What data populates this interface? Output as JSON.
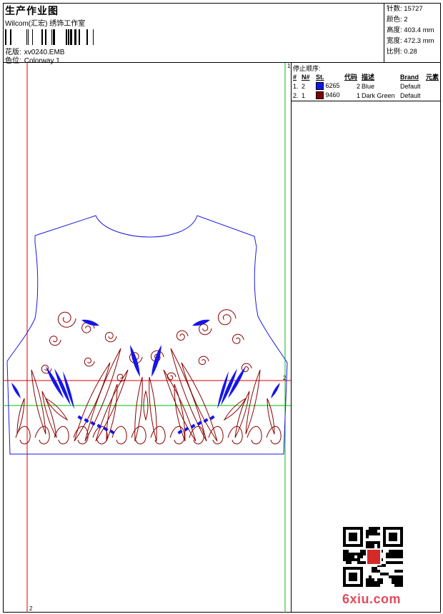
{
  "header": {
    "title": "生产作业图",
    "company": "Wilcom(汇宏) 绣饰工作室",
    "design_label": "花版:",
    "design_value": "xv0240.EMB",
    "colorway_label": "色位:",
    "colorway_value": "Colorway 1"
  },
  "stats": [
    {
      "label": "针数:",
      "value": "15727"
    },
    {
      "label": "颜色:",
      "value": "2"
    },
    {
      "label": "高度:",
      "value": "403.4 mm"
    },
    {
      "label": "宽度:",
      "value": "472.3 mm"
    },
    {
      "label": "比例:",
      "value": "0.28"
    }
  ],
  "stop_order": {
    "title": "停止顺序:",
    "columns": [
      "#",
      "N#",
      "St.",
      "代码",
      "描述",
      "Brand",
      "元素"
    ],
    "rows": [
      {
        "num": "1.",
        "n": "2",
        "code": "6265",
        "st": "2",
        "desc": "Blue",
        "brand": "Default",
        "color": "#1515e8"
      },
      {
        "num": "2.",
        "n": "1",
        "code": "9460",
        "st": "1",
        "desc": "Dark Green",
        "brand": "Default",
        "color": "#800000"
      }
    ]
  },
  "markers": {
    "top_right": "1",
    "mid_right": "2",
    "bottom_left": "2"
  },
  "watermark": "6xiu.com",
  "qr_seal": "壹吉印"
}
